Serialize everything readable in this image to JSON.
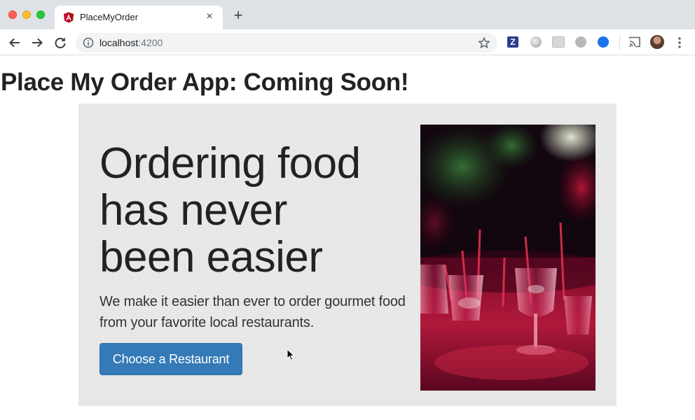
{
  "browser": {
    "tab_title": "PlaceMyOrder",
    "tab_close_glyph": "×",
    "new_tab_glyph": "+",
    "url_host": "localhost",
    "url_port": ":4200",
    "extension_z_label": "Z",
    "icons": [
      "angular-favicon-icon",
      "back-arrow-icon",
      "forward-arrow-icon",
      "reload-icon",
      "info-icon",
      "star-icon",
      "cast-icon",
      "avatar-icon",
      "menu-dots-icon",
      "cursor-icon"
    ]
  },
  "page": {
    "title": "Place My Order App: Coming Soon!",
    "hero": {
      "heading_lines": [
        "Ordering food",
        "has never",
        "been easier"
      ],
      "text_lines": [
        "We make it easier than ever to order gourmet food",
        "from your favorite local restaurants."
      ],
      "button_label": "Choose a Restaurant",
      "image": "restaurant-glasses-photo"
    }
  },
  "colors": {
    "primary_button": "#337ab7",
    "jumbotron_bg": "#e9e9e9",
    "text": "#222222"
  }
}
